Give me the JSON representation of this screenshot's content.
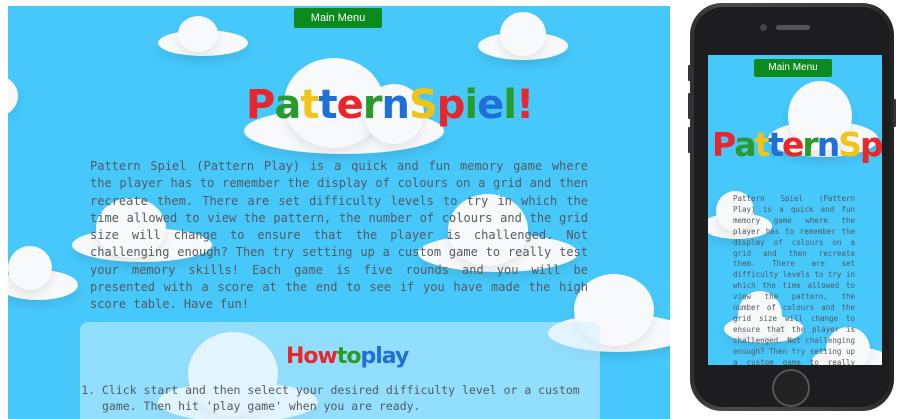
{
  "main_menu_label": "Main Menu",
  "logo": {
    "letters": [
      {
        "ch": "P",
        "color": "#e8262b"
      },
      {
        "ch": "a",
        "color": "#2a9a2a"
      },
      {
        "ch": "t",
        "color": "#f0c419"
      },
      {
        "ch": "t",
        "color": "#1f6fd6"
      },
      {
        "ch": "e",
        "color": "#e8262b"
      },
      {
        "ch": "r",
        "color": "#2a9a2a"
      },
      {
        "ch": "n",
        "color": "#1f6fd6"
      },
      {
        "ch": "S",
        "color": "#f0c419"
      },
      {
        "ch": "p",
        "color": "#e8262b"
      },
      {
        "ch": "i",
        "color": "#2a9a2a"
      },
      {
        "ch": "e",
        "color": "#1f6fd6"
      },
      {
        "ch": "l",
        "color": "#2a9a2a"
      },
      {
        "ch": "!",
        "color": "#e8262b"
      }
    ]
  },
  "description": "Pattern Spiel (Pattern Play) is a quick and fun memory game where the player has to remember the display of colours on a grid and then recreate them. There are set difficulty levels to try in which the time allowed to view the pattern, the number of colours and the grid size will change to ensure that the player is challenged. Not challenging enough? Then try setting up a custom game to really test your memory skills! Each game is five rounds and you will be presented with a score at the end to see if you have made the high score table. Have fun!",
  "how_to_play": {
    "title_parts": [
      {
        "text": "How",
        "color": "#e8262b"
      },
      {
        "text": "to",
        "color": "#2a9a2a"
      },
      {
        "text": "play",
        "color": "#1f6fd6"
      }
    ],
    "steps": [
      "Click start and then select your desired difficulty level or a custom game. Then hit 'play game' when you are ready."
    ]
  },
  "colors": {
    "sky": "#46c8fb",
    "button": "#0b8a1d",
    "text": "#555a60"
  }
}
